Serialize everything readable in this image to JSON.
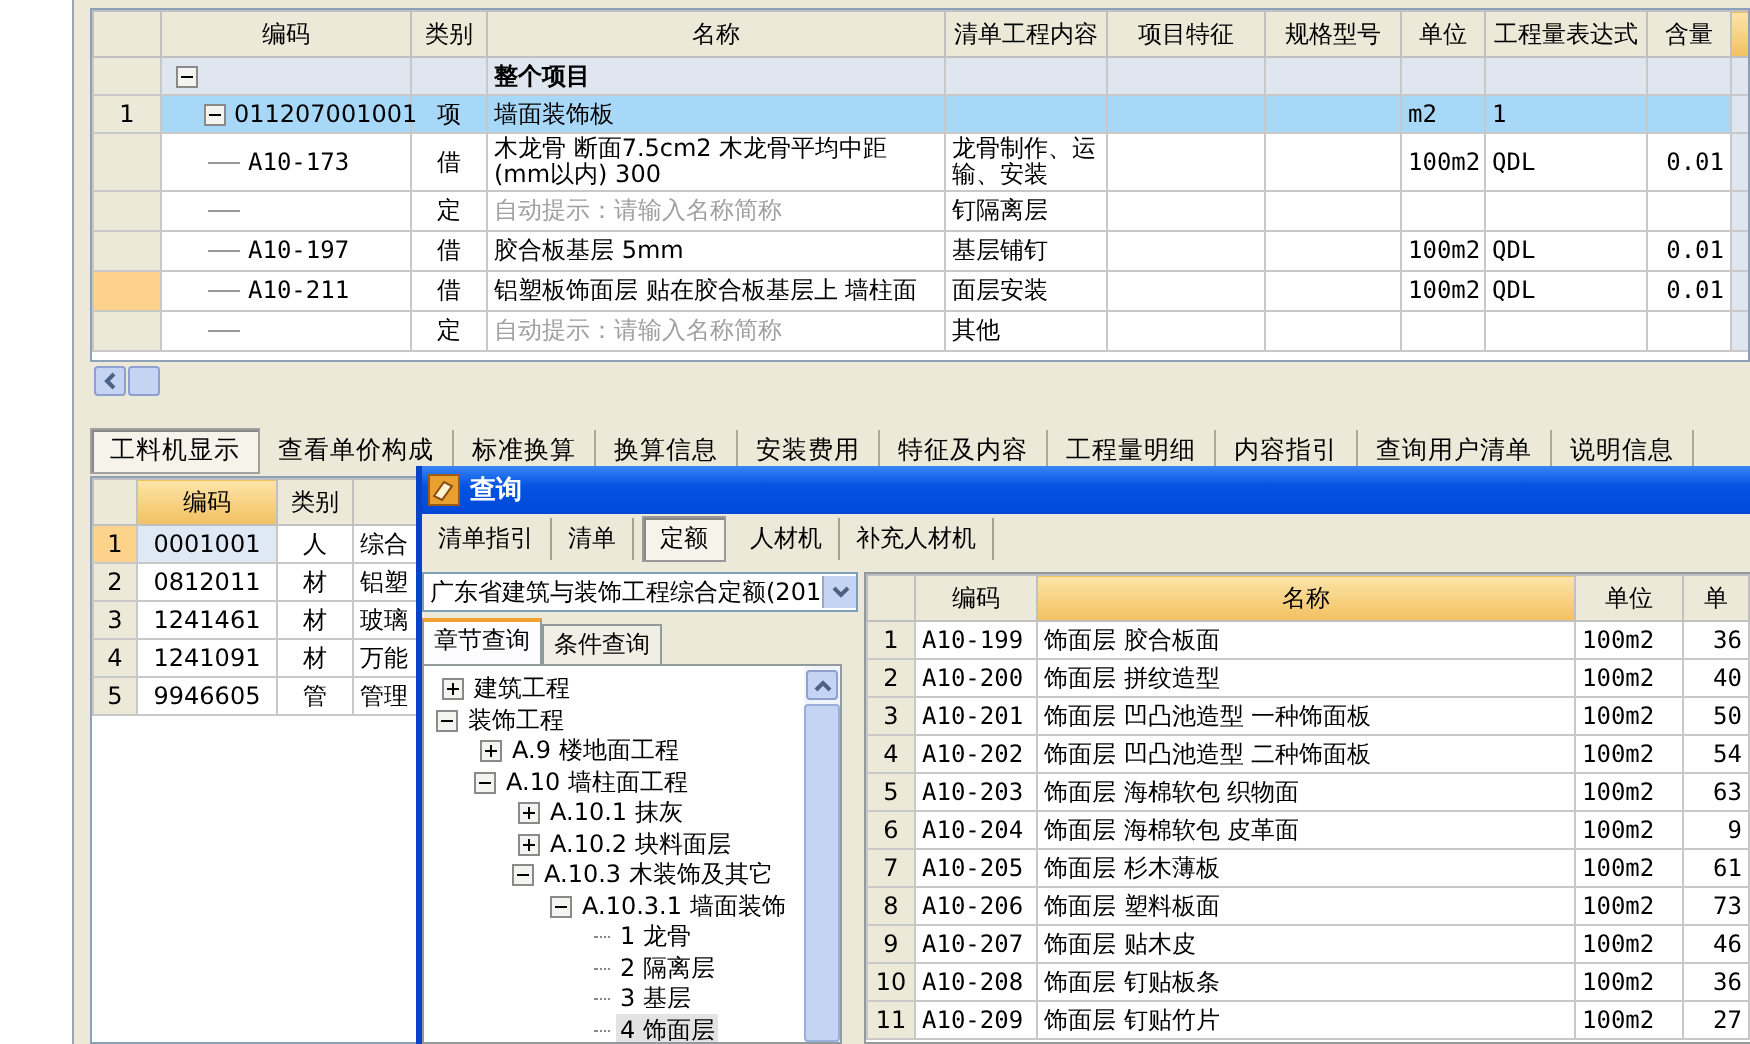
{
  "top_grid": {
    "columns": [
      "",
      "编码",
      "类别",
      "名称",
      "清单工程内容",
      "项目特征",
      "规格型号",
      "单位",
      "工程量表达式",
      "含量"
    ],
    "rows": [
      {
        "kind": "group",
        "name": "整个项目",
        "expanded": true,
        "selected": false,
        "current": false
      },
      {
        "kind": "bill",
        "number": "1",
        "code": "011207001001",
        "type": "项",
        "name": "墙面装饰板",
        "unit": "m2",
        "expression": "1",
        "expanded": true,
        "selected": true,
        "current": false
      },
      {
        "kind": "quota",
        "code": "A10-173",
        "type": "借",
        "name": "木龙骨 断面7.5cm2 木龙骨平均中距(mm以内) 300",
        "content": "龙骨制作、运输、安装",
        "unit": "100m2",
        "expression": "QDL",
        "quantity": "0.01",
        "selected": false,
        "current": false
      },
      {
        "kind": "hint",
        "type": "定",
        "name": "自动提示：请输入名称简称",
        "content": "钉隔离层",
        "selected": false,
        "current": false
      },
      {
        "kind": "quota",
        "code": "A10-197",
        "type": "借",
        "name": "胶合板基层 5mm",
        "content": "基层铺钉",
        "unit": "100m2",
        "expression": "QDL",
        "quantity": "0.01",
        "selected": false,
        "current": false
      },
      {
        "kind": "quota",
        "code": "A10-211",
        "type": "借",
        "name": "铝塑板饰面层 贴在胶合板基层上 墙柱面",
        "content": "面层安装",
        "unit": "100m2",
        "expression": "QDL",
        "quantity": "0.01",
        "selected": false,
        "current": true
      },
      {
        "kind": "hint",
        "type": "定",
        "name": "自动提示：请输入名称简称",
        "content": "其他",
        "selected": false,
        "current": false
      }
    ]
  },
  "detail_tabs": [
    {
      "label": "工料机显示",
      "selected": true
    },
    {
      "label": "查看单价构成",
      "selected": false
    },
    {
      "label": "标准换算",
      "selected": false
    },
    {
      "label": "换算信息",
      "selected": false
    },
    {
      "label": "安装费用",
      "selected": false
    },
    {
      "label": "特征及内容",
      "selected": false
    },
    {
      "label": "工程量明细",
      "selected": false
    },
    {
      "label": "内容指引",
      "selected": false
    },
    {
      "label": "查询用户清单",
      "selected": false
    },
    {
      "label": "说明信息",
      "selected": false
    }
  ],
  "resource_grid": {
    "columns": [
      "",
      "编码",
      "类别"
    ],
    "rows": [
      {
        "number": "1",
        "code": "0001001",
        "type": "人",
        "name": "综合",
        "selected": true
      },
      {
        "number": "2",
        "code": "0812011",
        "type": "材",
        "name": "铝塑",
        "selected": false
      },
      {
        "number": "3",
        "code": "1241461",
        "type": "材",
        "name": "玻璃",
        "selected": false
      },
      {
        "number": "4",
        "code": "1241091",
        "type": "材",
        "name": "万能",
        "selected": false
      },
      {
        "number": "5",
        "code": "9946605",
        "type": "管",
        "name": "管理",
        "selected": false
      }
    ]
  },
  "dialog": {
    "title": "查询",
    "tabs": [
      {
        "label": "清单指引",
        "selected": false
      },
      {
        "label": "清单",
        "selected": false
      },
      {
        "label": "定额",
        "selected": true
      },
      {
        "label": "人材机",
        "selected": false
      },
      {
        "label": "补充人材机",
        "selected": false
      }
    ],
    "library": {
      "value": "广东省建筑与装饰工程综合定额(201"
    },
    "search_tabs": [
      {
        "label": "章节查询",
        "selected": true
      },
      {
        "label": "条件查询",
        "selected": false
      }
    ],
    "tree": [
      {
        "label": "建筑工程",
        "expanded": false,
        "selected": false
      },
      {
        "label": "装饰工程",
        "expanded": true,
        "selected": false,
        "children": [
          {
            "label": "A.9 楼地面工程",
            "expanded": false,
            "selected": false
          },
          {
            "label": "A.10 墙柱面工程",
            "expanded": true,
            "selected": false,
            "children": [
              {
                "label": "A.10.1 抹灰",
                "expanded": false,
                "selected": false
              },
              {
                "label": "A.10.2 块料面层",
                "expanded": false,
                "selected": false
              },
              {
                "label": "A.10.3 木装饰及其它",
                "expanded": true,
                "selected": false,
                "children": [
                  {
                    "label": "A.10.3.1 墙面装饰",
                    "expanded": true,
                    "selected": false,
                    "children": [
                      {
                        "label": "1 龙骨",
                        "selected": false
                      },
                      {
                        "label": "2 隔离层",
                        "selected": false
                      },
                      {
                        "label": "3 基层",
                        "selected": false
                      },
                      {
                        "label": "4 饰面层",
                        "selected": true
                      }
                    ]
                  }
                ]
              }
            ]
          }
        ]
      }
    ],
    "results": {
      "columns": [
        "",
        "编码",
        "名称",
        "单位",
        "单"
      ],
      "rows": [
        {
          "number": "1",
          "code": "A10-199",
          "name": "饰面层 胶合板面",
          "unit": "100m2",
          "price": "36"
        },
        {
          "number": "2",
          "code": "A10-200",
          "name": "饰面层 拼纹造型",
          "unit": "100m2",
          "price": "40"
        },
        {
          "number": "3",
          "code": "A10-201",
          "name": "饰面层 凹凸池造型 一种饰面板",
          "unit": "100m2",
          "price": "50"
        },
        {
          "number": "4",
          "code": "A10-202",
          "name": "饰面层 凹凸池造型 二种饰面板",
          "unit": "100m2",
          "price": "54"
        },
        {
          "number": "5",
          "code": "A10-203",
          "name": "饰面层 海棉软包 织物面",
          "unit": "100m2",
          "price": "63"
        },
        {
          "number": "6",
          "code": "A10-204",
          "name": "饰面层 海棉软包 皮革面",
          "unit": "100m2",
          "price": "9"
        },
        {
          "number": "7",
          "code": "A10-205",
          "name": "饰面层 杉木薄板",
          "unit": "100m2",
          "price": "61"
        },
        {
          "number": "8",
          "code": "A10-206",
          "name": "饰面层 塑料板面",
          "unit": "100m2",
          "price": "73"
        },
        {
          "number": "9",
          "code": "A10-207",
          "name": "饰面层 贴木皮",
          "unit": "100m2",
          "price": "46"
        },
        {
          "number": "10",
          "code": "A10-208",
          "name": "饰面层 钉贴板条",
          "unit": "100m2",
          "price": "36"
        },
        {
          "number": "11",
          "code": "A10-209",
          "name": "饰面层 钉贴竹片",
          "unit": "100m2",
          "price": "27"
        }
      ]
    }
  }
}
